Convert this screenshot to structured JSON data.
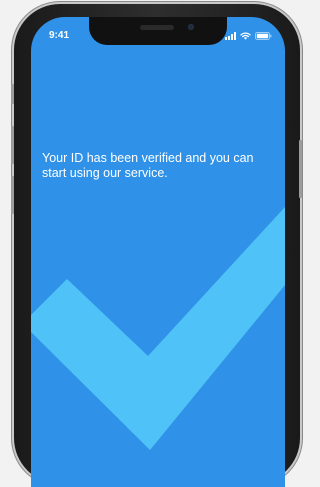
{
  "status_bar": {
    "time": "9:41",
    "icons": [
      "cellular-signal-icon",
      "wifi-icon",
      "battery-icon"
    ]
  },
  "screen": {
    "message": "Your ID has been verified and you can start using our service.",
    "background_color": "#2f92e8",
    "checkmark_color": "#4fc3f7",
    "checkmark_icon": "checkmark-icon"
  },
  "device": {
    "frame_color": "#1a1a1a"
  }
}
